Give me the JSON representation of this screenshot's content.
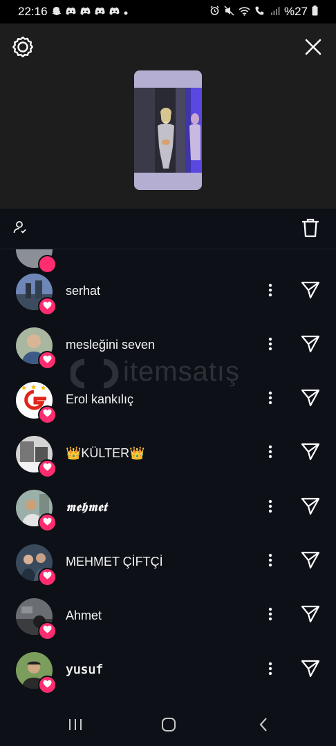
{
  "status_bar": {
    "time": "22:16",
    "battery": "%27",
    "left_icons": [
      "snapchat-icon",
      "discord-icon",
      "discord-icon",
      "discord-icon",
      "discord-icon",
      "dot-icon"
    ],
    "right_icons": [
      "alarm-icon",
      "mute-icon",
      "wifi-icon",
      "call-icon",
      "signal-icon",
      "battery-icon"
    ]
  },
  "header": {
    "settings_icon": "gear-icon",
    "close_icon": "close-icon"
  },
  "toolbar": {
    "viewers_icon": "viewers-icon",
    "delete_icon": "trash-icon"
  },
  "viewers": [
    {
      "name": "serhat",
      "style": "normal"
    },
    {
      "name": "mesleğini seven",
      "style": "normal"
    },
    {
      "name": "Erol kankılıç",
      "style": "normal"
    },
    {
      "name": "👑KÜLTER👑",
      "style": "normal"
    },
    {
      "name": "𝖒𝖊𝖍𝖒𝖊𝖙",
      "style": "fancy"
    },
    {
      "name": "MEHMET ÇİFTÇİ",
      "style": "normal"
    },
    {
      "name": "Ahmet",
      "style": "normal"
    },
    {
      "name": "𝚢𝚞𝚜𝚞𝚏",
      "style": "mono"
    }
  ],
  "watermark": {
    "text": "itemsatış"
  },
  "colors": {
    "background": "#0d1117",
    "header_bg": "#1d1d1d",
    "heart": "#ff2d6f"
  }
}
